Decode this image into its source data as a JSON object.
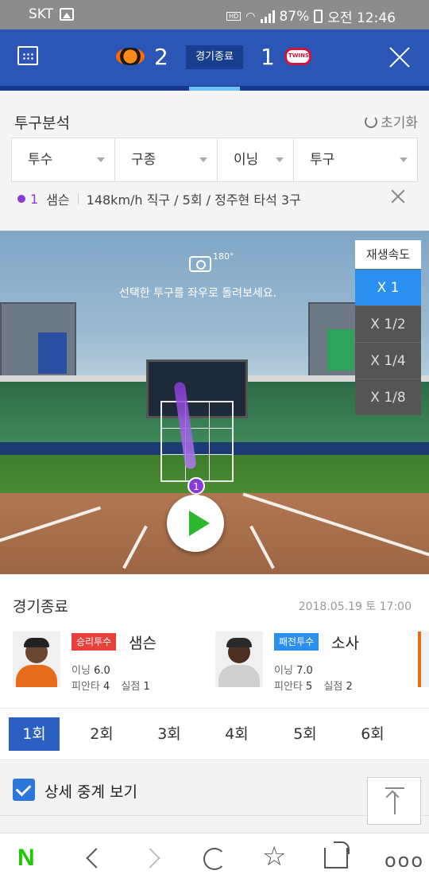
{
  "status_bar": {
    "carrier": "SKT",
    "hd": "HD",
    "battery": "87%",
    "time": "오전 12:46"
  },
  "scoreboard": {
    "away_score": "2",
    "home_score": "1",
    "game_status": "경기종료",
    "home_logo_text": "TWINS"
  },
  "analysis": {
    "title": "투구분석",
    "reset_label": "초기화",
    "filters": [
      {
        "label": "투수"
      },
      {
        "label": "구종"
      },
      {
        "label": "이닝"
      },
      {
        "label": "투구"
      }
    ],
    "pitch": {
      "number": "1",
      "pitcher": "샘슨",
      "detail": "148km/h 직구 / 5회 / 정주현 타석 3구",
      "color": "#8a3bd6"
    }
  },
  "viewer": {
    "rotate_degree": "180°",
    "hint": "선택한 투구를 좌우로 돌려보세요.",
    "speed_title": "재생속도",
    "speeds": [
      "X 1",
      "X 1/2",
      "X 1/4",
      "X 1/8"
    ],
    "selected_speed": "X 1",
    "marker": "1"
  },
  "result": {
    "title": "경기종료",
    "date": "2018.05.19 토 17:00",
    "winner": {
      "tag": "승리투수",
      "name": "샘슨",
      "inning_label": "이닝",
      "inning": "6.0",
      "hits_label": "피안타",
      "hits": "4",
      "runs_label": "실점",
      "runs": "1",
      "tag_color": "#e8413b"
    },
    "loser": {
      "tag": "패전투수",
      "name": "소사",
      "inning_label": "이닝",
      "inning": "7.0",
      "hits_label": "피안타",
      "hits": "5",
      "runs_label": "실점",
      "runs": "2",
      "tag_color": "#2b8ff0"
    }
  },
  "innings": {
    "tabs": [
      "1회",
      "2회",
      "3회",
      "4회",
      "5회",
      "6회"
    ],
    "selected": "1회"
  },
  "detail": {
    "label": "상세 중계 보기",
    "checked": true
  },
  "bottom_bar": {
    "logo": "N",
    "more": "ooo"
  }
}
